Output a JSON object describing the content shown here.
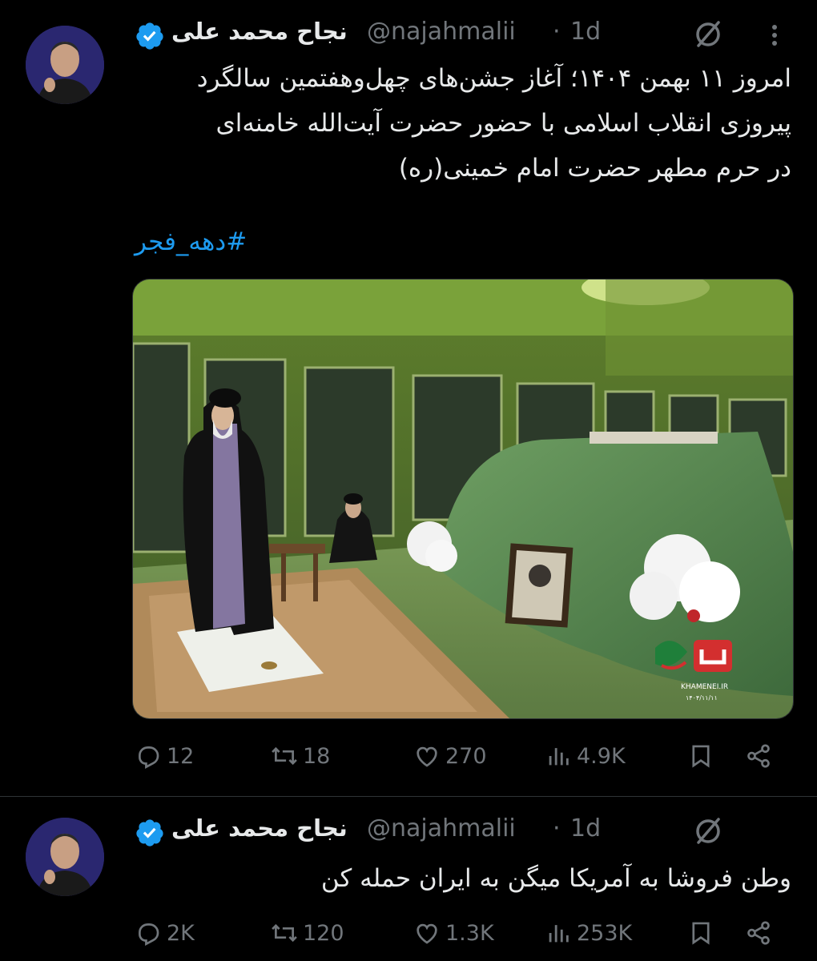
{
  "tweets": [
    {
      "author_name": "نجاح محمد علی",
      "handle": "@najahmalii",
      "separator": "·",
      "time": "1d",
      "text": "امروز ۱۱ بهمن ۱۴۰۴؛ آغاز جشن‌های چهل‌وهفتمین سالگرد\nپیروزی انقلاب اسلامی با حضور حضرت آیت‌الله خامنه‌ای\nدر حرم مطهر حضرت امام خمینی(ره)",
      "hashtag": "#دهه_فجر",
      "media": {
        "watermark": "KHAMENEI.IR",
        "watermark_date": "۱۴۰۴/۱۱/۱۱"
      },
      "stats": {
        "replies": "12",
        "reposts": "18",
        "likes": "270",
        "views": "4.9K"
      }
    },
    {
      "author_name": "نجاح محمد علی",
      "handle": "@najahmalii",
      "separator": "·",
      "time": "1d",
      "text": "وطن فروشا به آمریکا میگن به ایران حمله کن",
      "stats": {
        "replies": "2K",
        "reposts": "120",
        "likes": "1.3K",
        "views": "253K"
      }
    }
  ],
  "colors": {
    "accent": "#1d9bf0",
    "secondary_text": "#71767b",
    "background": "#000000"
  },
  "icons": [
    "verified-badge-icon",
    "grok-icon",
    "more-icon",
    "reply-icon",
    "repost-icon",
    "like-icon",
    "views-icon",
    "bookmark-icon",
    "share-icon"
  ]
}
